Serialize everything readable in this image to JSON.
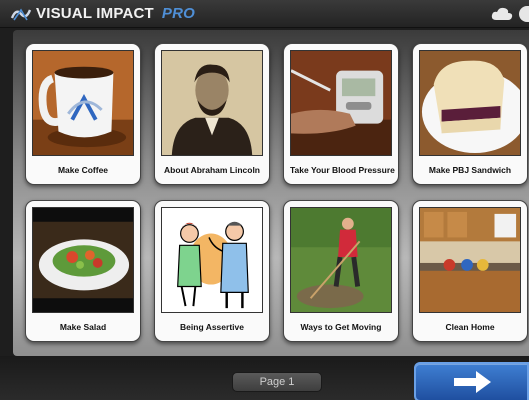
{
  "header": {
    "brand_main": "VISUAL IMPACT",
    "brand_suffix": "PRO",
    "icons": [
      "visual-impact-logo-icon",
      "cloud-icon"
    ]
  },
  "tiles": [
    {
      "label": "Make Coffee",
      "image": "coffee-mug"
    },
    {
      "label": "About Abraham Lincoln",
      "image": "abraham-lincoln-portrait"
    },
    {
      "label": "Take Your Blood Pressure",
      "image": "blood-pressure-monitor"
    },
    {
      "label": "Make PBJ Sandwich",
      "image": "pbj-sandwich"
    },
    {
      "label": "Make Salad",
      "image": "salad-bowl"
    },
    {
      "label": "Being Assertive",
      "image": "two-people-talking"
    },
    {
      "label": "Ways to Get Moving",
      "image": "person-raking-leaves"
    },
    {
      "label": "Clean Home",
      "image": "kitchen"
    }
  ],
  "footer": {
    "page_label": "Page 1",
    "next_icon": "arrow-right-icon"
  },
  "colors": {
    "accent_blue": "#2f67c0",
    "brand_pro": "#4f8fd6",
    "tile_bg": "#fafafa",
    "bar_bg": "#232323"
  }
}
